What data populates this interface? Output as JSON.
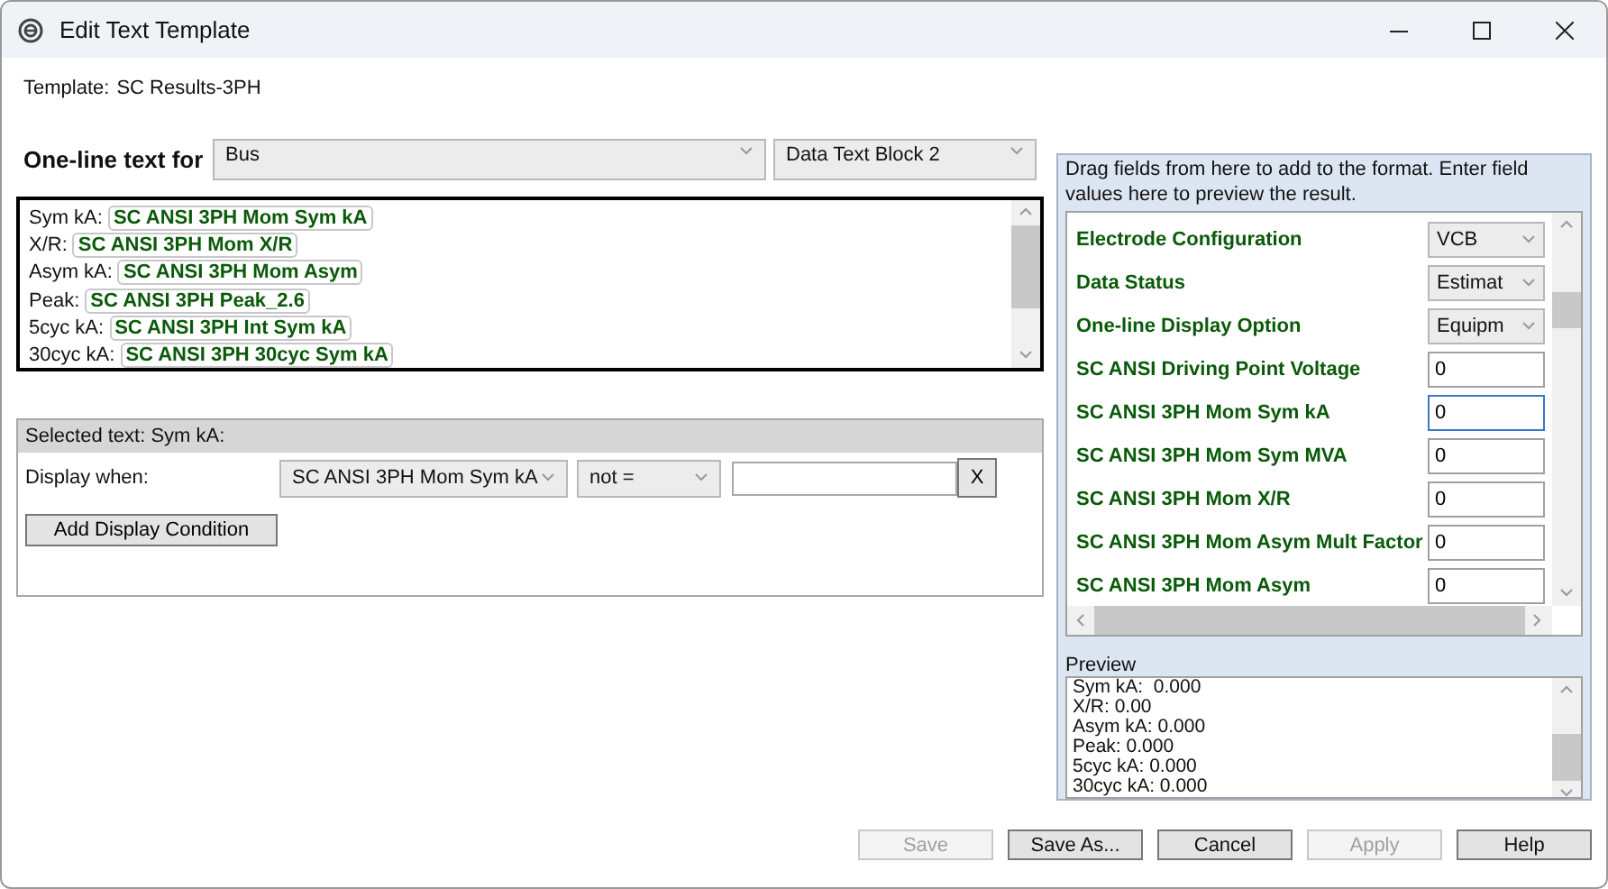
{
  "window": {
    "title": "Edit Text Template"
  },
  "template": {
    "label": "Template:",
    "value": "SC Results-3PH"
  },
  "one_line": {
    "label": "One-line text for",
    "element_select": "Bus",
    "block_select": "Data Text Block 2"
  },
  "format_lines": [
    {
      "label": "Sym kA:",
      "field": "SC ANSI 3PH Mom Sym kA"
    },
    {
      "label": "X/R:",
      "field": "SC ANSI 3PH Mom X/R"
    },
    {
      "label": "Asym kA:",
      "field": "SC ANSI 3PH Mom Asym"
    },
    {
      "label": "Peak:",
      "field": "SC ANSI 3PH Peak_2.6"
    },
    {
      "label": "5cyc kA:",
      "field": "SC ANSI 3PH Int Sym kA"
    },
    {
      "label": "30cyc kA:",
      "field": "SC ANSI 3PH 30cyc Sym kA"
    }
  ],
  "selected_text": {
    "title": "Selected text: Sym kA:",
    "display_when_label": "Display when:",
    "field_select": "SC ANSI 3PH Mom Sym kA",
    "operator_select": "not =",
    "clear_button": "X",
    "add_button": "Add Display Condition"
  },
  "fields_panel": {
    "hint": "Drag fields from here to add to the format.  Enter field values here to preview the result.",
    "fields": [
      {
        "kind": "select",
        "name": "Electrode Configuration",
        "value": "VCB",
        "focused": false
      },
      {
        "kind": "select",
        "name": "Data Status",
        "value": "Estimat",
        "focused": false
      },
      {
        "kind": "select",
        "name": "One-line Display Option",
        "value": "Equipm",
        "focused": false
      },
      {
        "kind": "input",
        "name": "SC ANSI Driving Point Voltage",
        "value": "0",
        "focused": false
      },
      {
        "kind": "input",
        "name": "SC ANSI 3PH Mom Sym kA",
        "value": "0",
        "focused": true
      },
      {
        "kind": "input",
        "name": "SC ANSI 3PH Mom Sym MVA",
        "value": "0",
        "focused": false
      },
      {
        "kind": "input",
        "name": "SC ANSI 3PH Mom X/R",
        "value": "0",
        "focused": false
      },
      {
        "kind": "input",
        "name": "SC ANSI 3PH Mom Asym Mult Factor",
        "value": "0",
        "focused": false
      },
      {
        "kind": "input",
        "name": "SC ANSI 3PH Mom Asym",
        "value": "0",
        "focused": false
      }
    ],
    "preview_label": "Preview",
    "preview_lines": [
      "Sym kA:  0.000",
      "X/R: 0.00",
      "Asym kA: 0.000",
      "Peak: 0.000",
      "5cyc kA: 0.000",
      "30cyc kA: 0.000"
    ]
  },
  "buttons": [
    {
      "label": "Save",
      "disabled": true
    },
    {
      "label": "Save As...",
      "disabled": false
    },
    {
      "label": "Cancel",
      "disabled": false
    },
    {
      "label": "Apply",
      "disabled": true
    },
    {
      "label": "Help",
      "disabled": false
    }
  ]
}
